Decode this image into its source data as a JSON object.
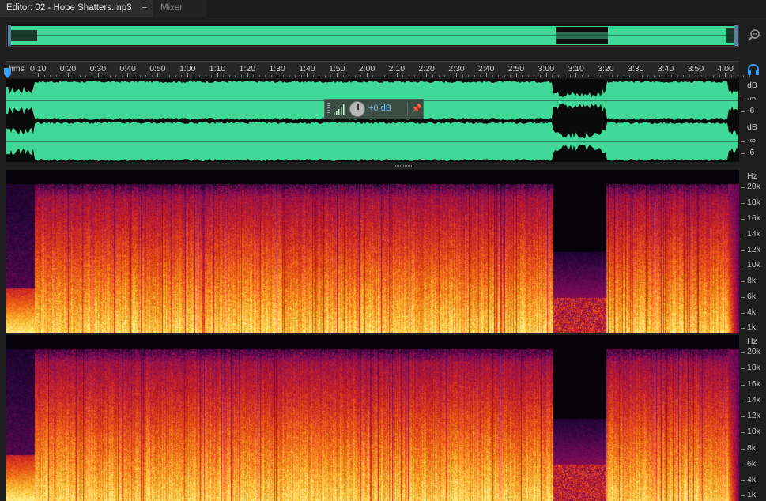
{
  "tabs": {
    "editor_label": "Editor: 02 - Hope Shatters.mp3",
    "editor_menu": "≡",
    "mixer_label": "Mixer"
  },
  "icons": {
    "zoom": "zoom-icon",
    "headphones": "headphones-icon",
    "playhead": "playhead-marker-icon",
    "pin": "pin-icon"
  },
  "ruler": {
    "unit_label": "hms",
    "ticks": [
      "0:10",
      "0:20",
      "0:30",
      "0:40",
      "0:50",
      "1:00",
      "1:10",
      "1:20",
      "1:30",
      "1:40",
      "1:50",
      "2:00",
      "2:10",
      "2:20",
      "2:30",
      "2:40",
      "2:50",
      "3:00",
      "3:10",
      "3:20",
      "3:30",
      "3:40",
      "3:50",
      "4:00"
    ]
  },
  "hud": {
    "gain": "+0 dB"
  },
  "waveform_scale": {
    "channels": [
      {
        "unit": "dB",
        "labels": [
          "-∞",
          "-6"
        ]
      },
      {
        "unit": "dB",
        "labels": [
          "-∞",
          "-6"
        ]
      }
    ]
  },
  "spectral_scale": {
    "unit": "Hz",
    "labels": [
      "20k",
      "18k",
      "16k",
      "14k",
      "12k",
      "10k",
      "8k",
      "6k",
      "4k",
      "1k"
    ]
  },
  "colors": {
    "waveform": "#3fd896",
    "background": "#1e1e1e",
    "accent": "#3aa0ff",
    "hud_text": "#6fc0ff"
  }
}
